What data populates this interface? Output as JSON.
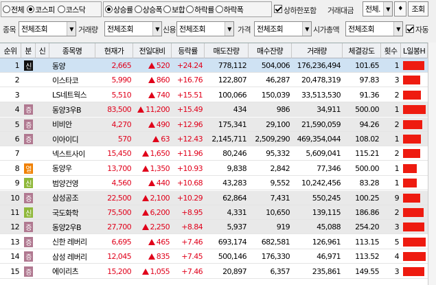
{
  "toolbar": {
    "market_options": [
      {
        "label": "전체",
        "checked": false
      },
      {
        "label": "코스피",
        "checked": true
      },
      {
        "label": "코스닥",
        "checked": false
      }
    ],
    "direction_options": [
      {
        "label": "상승률",
        "checked": true
      },
      {
        "label": "상승폭",
        "checked": false
      },
      {
        "label": "보합",
        "checked": false
      },
      {
        "label": "하락률",
        "checked": false
      },
      {
        "label": "하락폭",
        "checked": false
      }
    ],
    "include_limit_label": "상하한포함",
    "include_limit_checked": true,
    "trade_amount_label": "거래대금",
    "trade_amount_value": "전체.",
    "query_button": "조회"
  },
  "filters": {
    "sector_label": "종목",
    "sector_value": "전체조회",
    "volume_label": "거래량",
    "volume_value": "전체조회",
    "credit_label": "신용",
    "credit_value": "전체조회",
    "price_label": "가격",
    "price_value": "전체조회",
    "marketcap_label": "시가총액",
    "marketcap_value": "전체조회",
    "auto_label": "자동",
    "auto_checked": true
  },
  "table": {
    "headers": [
      "순위",
      "분",
      "신",
      "종목명",
      "현재가",
      "전일대비",
      "등락률",
      "매도잔량",
      "매수잔량",
      "거래량",
      "체결강도",
      "횟수",
      "L일봉H"
    ],
    "rows": [
      {
        "rank": "1",
        "div": "신",
        "divColor": "#111111",
        "name": "동양",
        "price": "2,665",
        "change": "520",
        "rate": "+24.24",
        "ask": "778,112",
        "bid": "504,006",
        "volume": "176,236,494",
        "strength": "101.65",
        "count": "1",
        "lh": 0.95
      },
      {
        "rank": "2",
        "div": "",
        "divColor": "",
        "name": "이스타코",
        "price": "5,990",
        "change": "860",
        "rate": "+16.76",
        "ask": "122,807",
        "bid": "46,287",
        "volume": "20,478,319",
        "strength": "97.83",
        "count": "3",
        "lh": 0.75
      },
      {
        "rank": "3",
        "div": "",
        "divColor": "",
        "name": "LS네트웍스",
        "price": "5,510",
        "change": "740",
        "rate": "+15.51",
        "ask": "100,066",
        "bid": "150,039",
        "volume": "33,513,530",
        "strength": "91.36",
        "count": "2",
        "lh": 0.8
      },
      {
        "rank": "4",
        "div": "증",
        "divColor": "#b07890",
        "name": "동양3우B",
        "price": "83,500",
        "change": "11,200",
        "rate": "+15.49",
        "ask": "434",
        "bid": "986",
        "volume": "34,911",
        "strength": "500.00",
        "count": "1",
        "lh": 1.0
      },
      {
        "rank": "5",
        "div": "증",
        "divColor": "#b07890",
        "name": "비비안",
        "price": "4,270",
        "change": "490",
        "rate": "+12.96",
        "ask": "175,341",
        "bid": "29,100",
        "volume": "21,590,059",
        "strength": "94.26",
        "count": "2",
        "lh": 0.85
      },
      {
        "rank": "6",
        "div": "증",
        "divColor": "#b07890",
        "name": "이아이디",
        "price": "570",
        "change": "63",
        "rate": "+12.43",
        "ask": "2,145,711",
        "bid": "2,509,290",
        "volume": "469,354,044",
        "strength": "108.02",
        "count": "1",
        "lh": 0.8
      },
      {
        "rank": "7",
        "div": "",
        "divColor": "",
        "name": "넥스트사이",
        "price": "15,450",
        "change": "1,650",
        "rate": "+11.96",
        "ask": "80,246",
        "bid": "95,332",
        "volume": "5,609,041",
        "strength": "115.21",
        "count": "2",
        "lh": 0.75
      },
      {
        "rank": "8",
        "div": "열",
        "divColor": "#f08000",
        "name": "동양우",
        "price": "13,700",
        "change": "1,350",
        "rate": "+10.93",
        "ask": "9,838",
        "bid": "2,842",
        "volume": "77,346",
        "strength": "500.00",
        "count": "1",
        "lh": 0.6
      },
      {
        "rank": "9",
        "div": "신",
        "divColor": "#8fb83a",
        "name": "범양건영",
        "price": "4,560",
        "change": "440",
        "rate": "+10.68",
        "ask": "43,283",
        "bid": "9,552",
        "volume": "10,242,456",
        "strength": "83.28",
        "count": "1",
        "lh": 0.6
      },
      {
        "rank": "10",
        "div": "증",
        "divColor": "#b07890",
        "name": "삼성공조",
        "price": "22,500",
        "change": "2,100",
        "rate": "+10.29",
        "ask": "62,864",
        "bid": "7,431",
        "volume": "550,245",
        "strength": "100.25",
        "count": "9",
        "lh": 0.75
      },
      {
        "rank": "11",
        "div": "신",
        "divColor": "#8fb83a",
        "name": "국도화학",
        "price": "75,500",
        "change": "6,200",
        "rate": "+8.95",
        "ask": "4,331",
        "bid": "10,650",
        "volume": "139,115",
        "strength": "186.86",
        "count": "2",
        "lh": 0.9
      },
      {
        "rank": "12",
        "div": "증",
        "divColor": "#b07890",
        "name": "동양2우B",
        "price": "27,700",
        "change": "2,250",
        "rate": "+8.84",
        "ask": "5,937",
        "bid": "919",
        "volume": "45,088",
        "strength": "254.20",
        "count": "3",
        "lh": 0.95
      },
      {
        "rank": "13",
        "div": "증",
        "divColor": "#b07890",
        "name": "신한 레버리",
        "price": "6,695",
        "change": "465",
        "rate": "+7.46",
        "ask": "693,174",
        "bid": "682,581",
        "volume": "126,961",
        "strength": "113.15",
        "count": "5",
        "lh": 1.0
      },
      {
        "rank": "14",
        "div": "증",
        "divColor": "#b07890",
        "name": "삼성 레버리",
        "price": "12,045",
        "change": "835",
        "rate": "+7.45",
        "ask": "500,146",
        "bid": "176,330",
        "volume": "46,971",
        "strength": "113.52",
        "count": "4",
        "lh": 1.0
      },
      {
        "rank": "15",
        "div": "증",
        "divColor": "#b07890",
        "name": "에이리츠",
        "price": "15,200",
        "change": "1,055",
        "rate": "+7.46",
        "ask": "20,897",
        "bid": "6,357",
        "volume": "235,861",
        "strength": "149.55",
        "count": "3",
        "lh": 0.95
      }
    ]
  }
}
